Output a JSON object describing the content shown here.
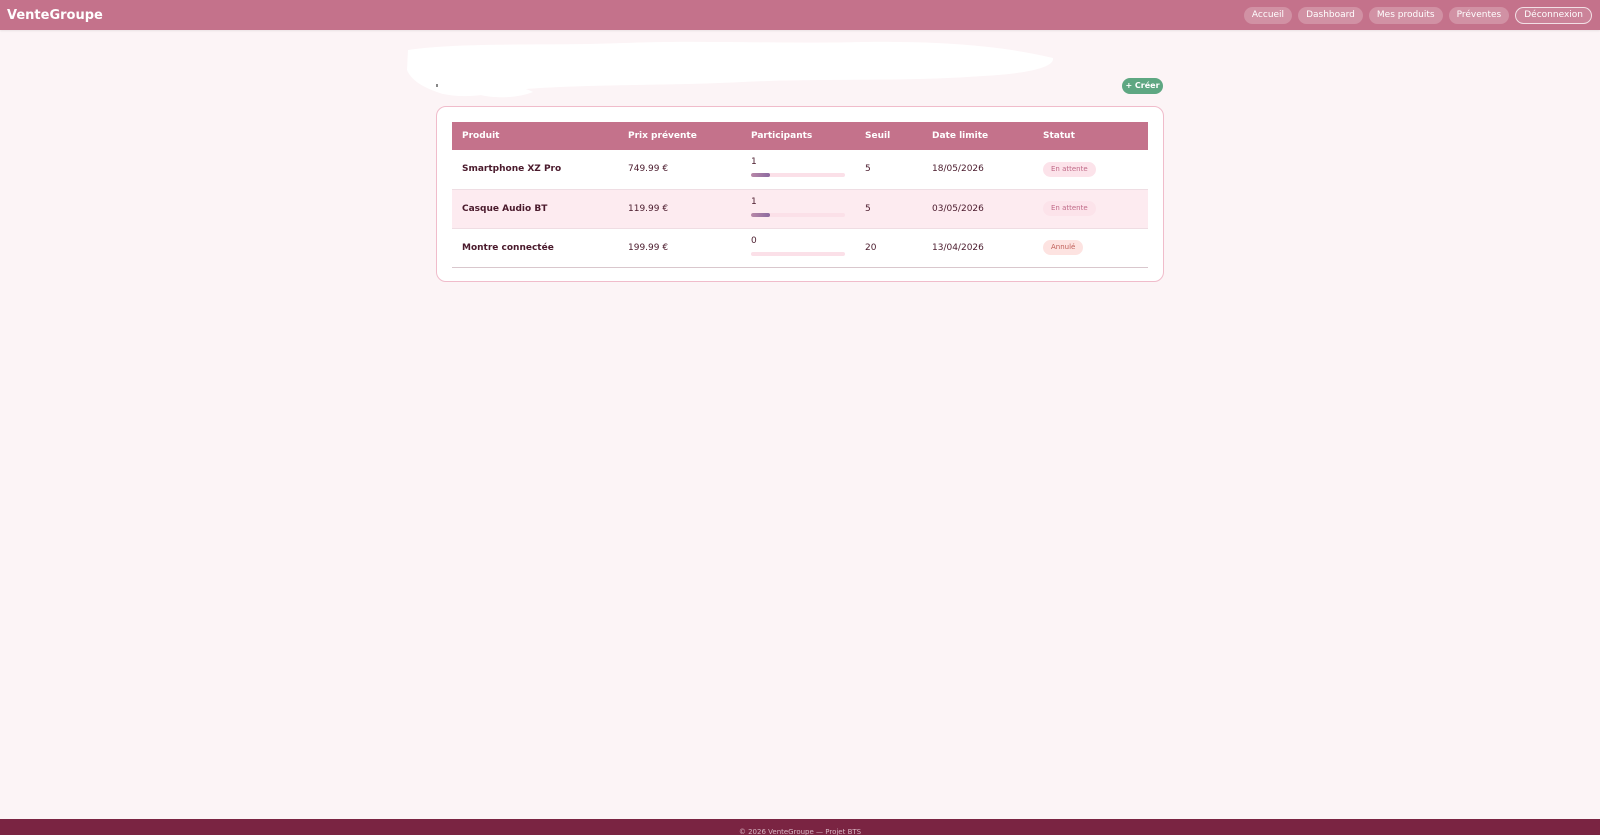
{
  "brand": "VenteGroupe",
  "nav": {
    "items": [
      "Accueil",
      "Dashboard",
      "Mes produits",
      "Préventes"
    ],
    "logout": "Déconnexion"
  },
  "create_button": "+ Créer",
  "table": {
    "headers": [
      "Produit",
      "Prix prévente",
      "Participants",
      "Seuil",
      "Date limite",
      "Statut"
    ],
    "rows": [
      {
        "product": "Smartphone XZ Pro",
        "price": "749.99 €",
        "participants": "1",
        "progress_fraction": 0.2,
        "threshold": "5",
        "deadline": "18/05/2026",
        "status": "En attente",
        "status_bg": "#fce3ea",
        "status_color": "#c06a88"
      },
      {
        "product": "Casque Audio BT",
        "price": "119.99 €",
        "participants": "1",
        "progress_fraction": 0.2,
        "threshold": "5",
        "deadline": "03/05/2026",
        "status": "En attente",
        "status_bg": "#fce3ea",
        "status_color": "#c06a88"
      },
      {
        "product": "Montre connectée",
        "price": "199.99 €",
        "participants": "0",
        "progress_fraction": 0.0,
        "threshold": "20",
        "deadline": "13/04/2026",
        "status": "Annulé",
        "status_bg": "#fde3e1",
        "status_color": "#c0605a"
      }
    ]
  },
  "footer": "© 2026 VenteGroupe — Projet BTS"
}
